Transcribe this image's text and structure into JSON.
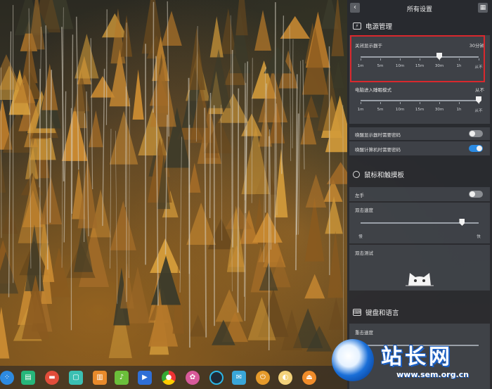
{
  "panel": {
    "title": "所有设置",
    "back_icon": "back-arrow-icon",
    "grid_icon": "grid-icon"
  },
  "power": {
    "section_title": "电源管理",
    "display_off": {
      "label": "关闭显示器于",
      "value": "30分钟",
      "ticks": [
        "1m",
        "5m",
        "10m",
        "15m",
        "30m",
        "1h",
        "从不"
      ],
      "selected_index": 4
    },
    "sleep": {
      "label": "电脑进入睡眠模式",
      "value": "从不",
      "ticks": [
        "1m",
        "5m",
        "10m",
        "15m",
        "30m",
        "1h",
        "从不"
      ],
      "selected_index": 6
    },
    "wake_display_password": {
      "label": "唤醒显示器时需要密码",
      "on": false
    },
    "wake_computer_password": {
      "label": "唤醒计算机时需要密码",
      "on": true
    }
  },
  "mouse": {
    "section_title": "鼠标和触摸板",
    "left_hand": {
      "label": "左手",
      "on": false
    },
    "double_click_speed": {
      "label": "双击速度",
      "min_label": "慢",
      "max_label": "快",
      "level": 0.86
    },
    "double_click_test": {
      "label": "双击测试"
    }
  },
  "keyboard": {
    "section_title": "键盘和语言",
    "repeat_speed_label": "重击速度"
  },
  "watermark": {
    "title": "站长网",
    "url": "www.sem.org.cn"
  },
  "colors": {
    "highlight": "#d9282d",
    "toggle_on": "#2a8ae2"
  }
}
